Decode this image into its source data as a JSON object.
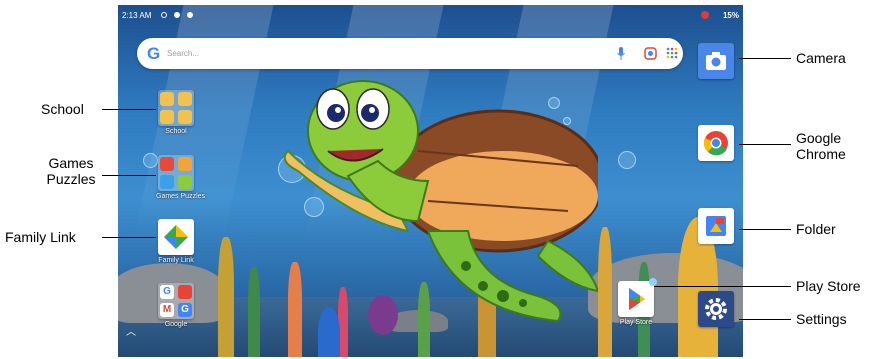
{
  "status_bar": {
    "time": "2:13 AM",
    "battery": "15%"
  },
  "search_bar": {
    "placeholder": "Search..."
  },
  "home_apps": {
    "school": "School",
    "games_puzzles": "Games Puzzles",
    "family_link": "Family Link",
    "google": "Google",
    "play_store": "Play Store"
  },
  "callouts": {
    "school": "School",
    "games_puzzles_1": "Games",
    "games_puzzles_2": "Puzzles",
    "family_link": "Family Link",
    "camera": "Camera",
    "chrome_1": "Google",
    "chrome_2": "Chrome",
    "folder": "Folder",
    "play_store": "Play Store",
    "settings": "Settings"
  },
  "colors": {
    "google_blue": "#4285f4",
    "google_red": "#ea4335",
    "google_yellow": "#fbbc05",
    "google_green": "#34a853",
    "camera_tile": "#4a86e8",
    "settings_tile": "#2c4a8a"
  },
  "icons": {
    "status": [
      "settings-status-icon",
      "cast-icon",
      "location-icon",
      "record-icon"
    ],
    "search": [
      "mic-icon",
      "lens-icon",
      "apps-grid-icon"
    ]
  }
}
